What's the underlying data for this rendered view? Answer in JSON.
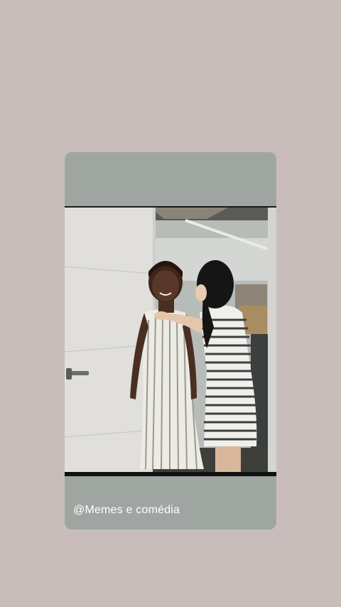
{
  "post": {
    "caption": "@Memes e comédia"
  },
  "media": {
    "description_icon": "video-frame"
  },
  "colors": {
    "background": "#c9bdbb",
    "card": "#9fa6a2",
    "caption_text": "#ffffff"
  }
}
